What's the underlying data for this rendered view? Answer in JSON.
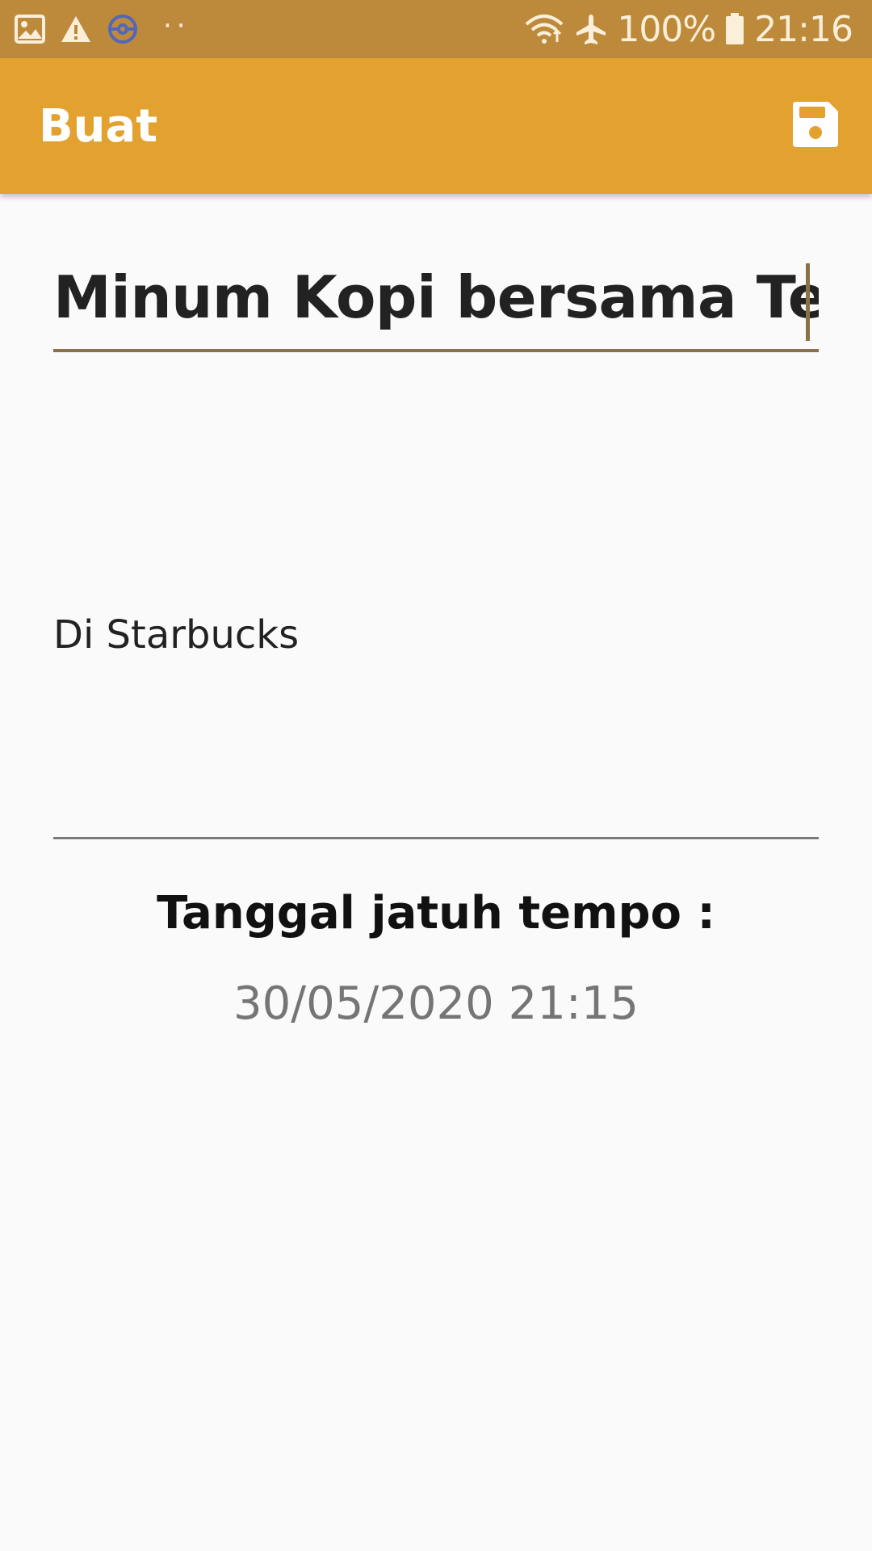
{
  "status_bar": {
    "battery": "100%",
    "time": "21:16",
    "left_icons": [
      "image-icon",
      "warning-icon",
      "pokeball-icon",
      "more-dots-icon"
    ],
    "right_icons": [
      "wifi-icon",
      "airplane-icon",
      "battery-icon"
    ]
  },
  "app_bar": {
    "title": "Buat",
    "save_icon": "save-icon",
    "color": "#e3a12f"
  },
  "form": {
    "title_value": "Minum Kopi bersama Tema",
    "description_value": "Di Starbucks",
    "due_label": "Tanggal jatuh tempo :",
    "due_value": "30/05/2020 21:15"
  },
  "colors": {
    "status_bar": "#bd8a3c",
    "accent_underline": "#8b7148",
    "background": "#fafafa"
  }
}
